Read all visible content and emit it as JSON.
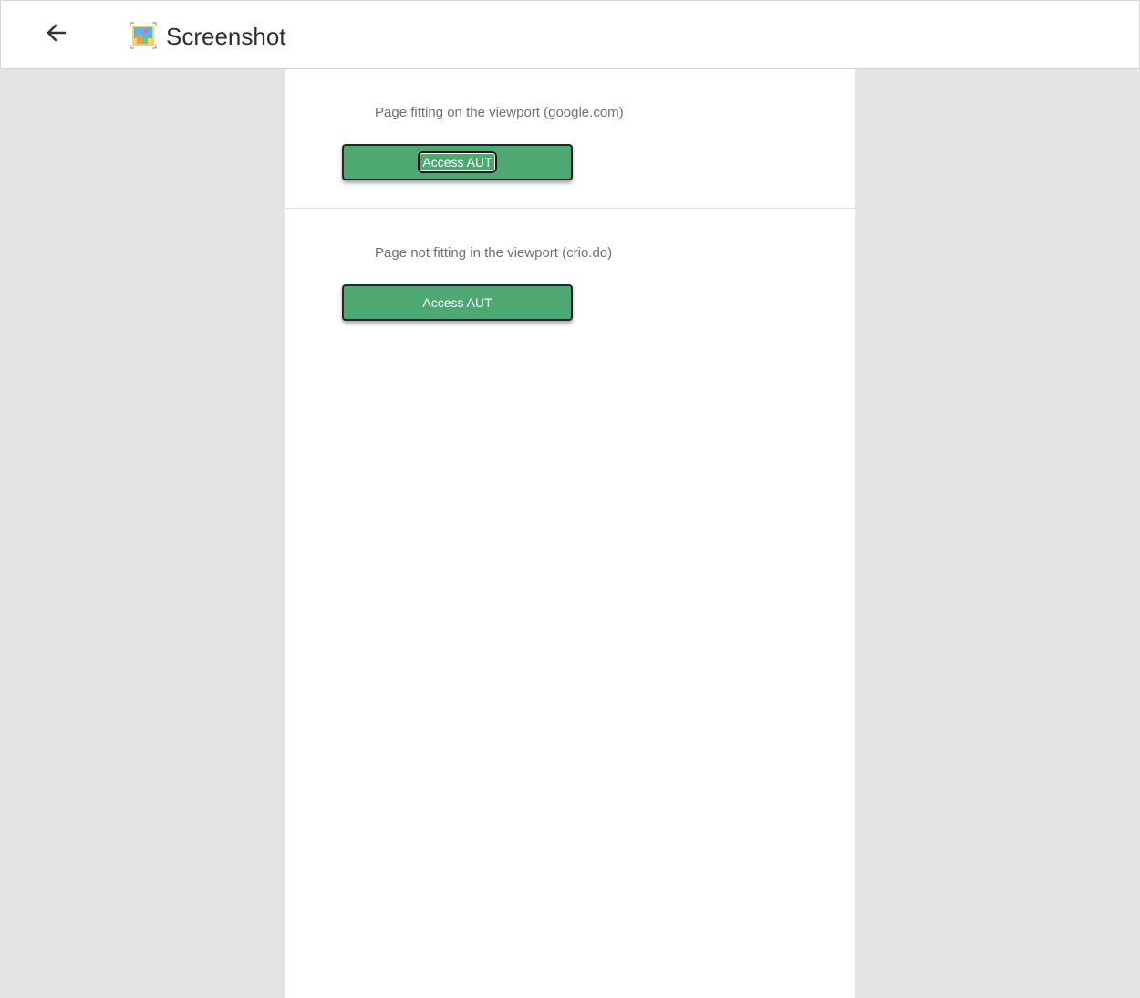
{
  "header": {
    "back_icon": "arrow-left-icon",
    "app_icon": "screenshot-app-icon",
    "title": "Screenshot"
  },
  "main": {
    "sections": [
      {
        "label": "Page fitting on the viewport (google.com)",
        "button_label": "Access AUT",
        "focused": true
      },
      {
        "label": "Page not fitting in the viewport (crio.do)",
        "button_label": "Access AUT",
        "focused": false
      }
    ]
  },
  "colors": {
    "button_green": "#4ea872",
    "background_gray": "#e4e4e4"
  }
}
